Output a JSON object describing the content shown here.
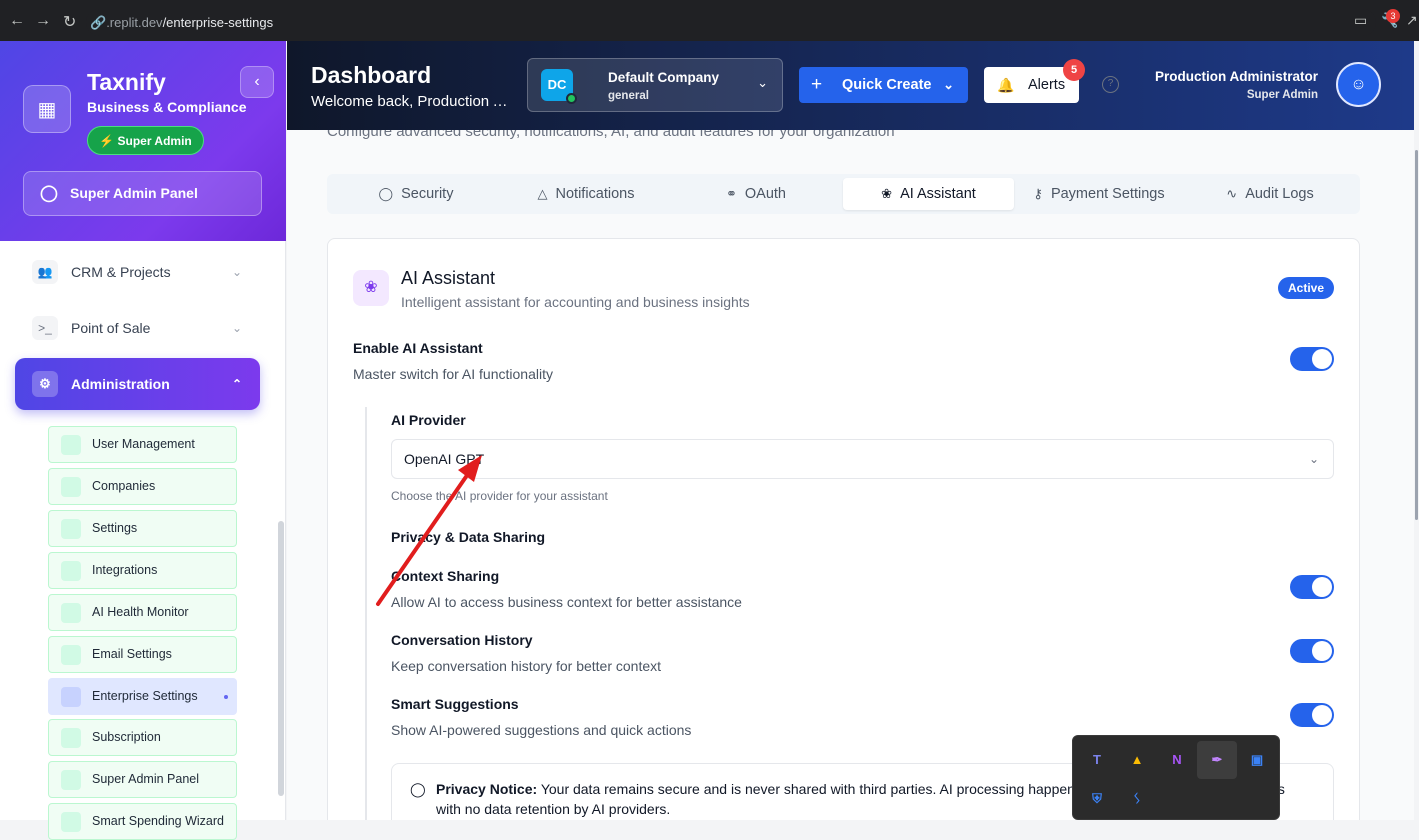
{
  "browser": {
    "url_prefix": ".replit.dev",
    "url_path": "/enterprise-settings",
    "badge_count": "3"
  },
  "sidebar": {
    "brand": "Taxnify",
    "brand_sub": "Business & Compliance",
    "role_pill": "Super Admin",
    "super_admin_panel": "Super Admin Panel",
    "sections": [
      {
        "label": "CRM & Projects"
      },
      {
        "label": "Point of Sale"
      }
    ],
    "administration": "Administration",
    "sub_items": [
      {
        "label": "User Management"
      },
      {
        "label": "Companies"
      },
      {
        "label": "Settings"
      },
      {
        "label": "Integrations"
      },
      {
        "label": "AI Health Monitor"
      },
      {
        "label": "Email Settings"
      },
      {
        "label": "Enterprise Settings",
        "active": true
      },
      {
        "label": "Subscription"
      },
      {
        "label": "Super Admin Panel"
      },
      {
        "label": "Smart Spending Wizard"
      }
    ]
  },
  "header": {
    "title": "Dashboard",
    "subtitle": "Welcome back, Production Administrator",
    "company": {
      "initials": "DC",
      "name": "Default Company",
      "type": "general"
    },
    "quick_create": "Quick Create",
    "alerts": "Alerts",
    "alerts_count": "5",
    "user_name": "Production Administrator",
    "user_role": "Super Admin"
  },
  "main": {
    "page_desc": "Configure advanced security, notifications, AI, and audit features for your organization",
    "tabs": [
      {
        "label": "Security",
        "icon": "shield-icon"
      },
      {
        "label": "Notifications",
        "icon": "bell-icon"
      },
      {
        "label": "OAuth",
        "icon": "globe-icon"
      },
      {
        "label": "AI Assistant",
        "icon": "brain-icon",
        "active": true
      },
      {
        "label": "Payment Settings",
        "icon": "key-icon"
      },
      {
        "label": "Audit Logs",
        "icon": "activity-icon"
      }
    ],
    "card": {
      "title": "AI Assistant",
      "subtitle": "Intelligent assistant for accounting and business insights",
      "status": "Active",
      "enable_label": "Enable AI Assistant",
      "enable_desc": "Master switch for AI functionality",
      "enable_on": true,
      "provider_label": "AI Provider",
      "provider_value": "OpenAI GPT",
      "provider_hint": "Choose the AI provider for your assistant",
      "privacy_heading": "Privacy & Data Sharing",
      "settings": [
        {
          "label": "Context Sharing",
          "desc": "Allow AI to access business context for better assistance",
          "on": true
        },
        {
          "label": "Conversation History",
          "desc": "Keep conversation history for better context",
          "on": true
        },
        {
          "label": "Smart Suggestions",
          "desc": "Show AI-powered suggestions and quick actions",
          "on": true
        }
      ],
      "notice_title": "Privacy Notice:",
      "notice_text": "Your data remains secure and is never shared with third parties. AI processing happens",
      "notice_text_end": "ts",
      "notice_text2": "with no data retention by AI providers."
    }
  },
  "tray": {
    "icons": [
      "teams-icon",
      "google-drive-icon",
      "onenote-icon",
      "feather-icon",
      "window-icon",
      "defender-icon",
      "bluetooth-icon"
    ]
  },
  "colors": {
    "accent": "#2563eb",
    "sidebar_gradient_start": "#4f46e5",
    "sidebar_gradient_end": "#7c3aed",
    "annotation_arrow": "#e11d1d"
  }
}
